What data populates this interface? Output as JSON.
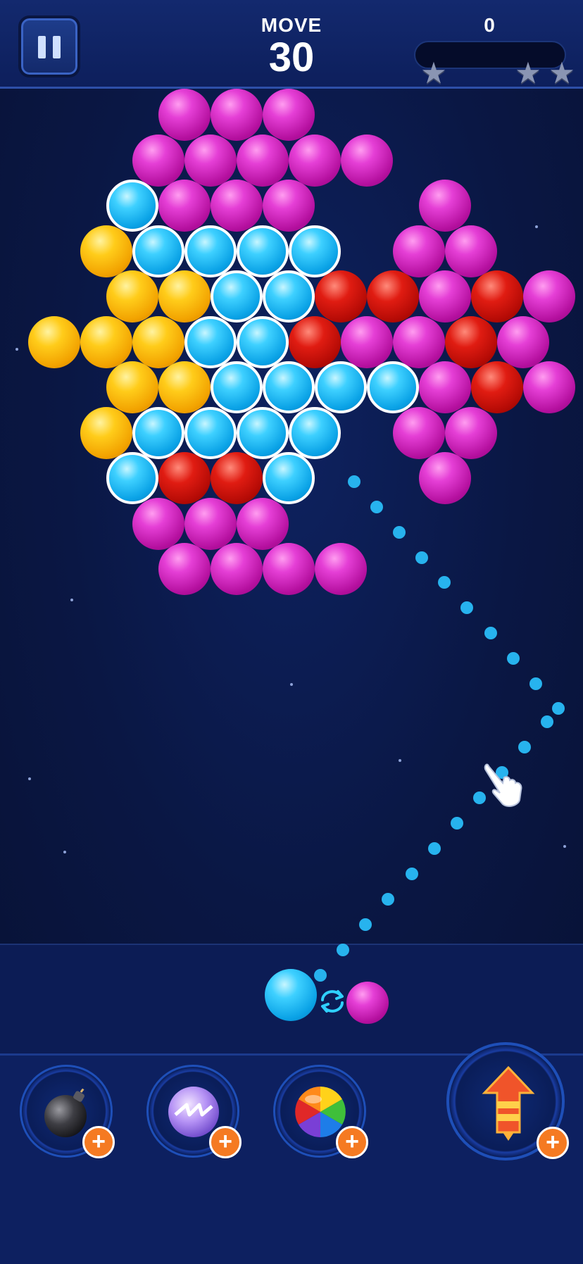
{
  "hud": {
    "pause_icon": "pause-icon",
    "move_label": "MOVE",
    "moves_left": "30",
    "score": "0",
    "score_progress": 0,
    "stars_earned": 0,
    "stars_total": 3,
    "star_icon": "star-icon"
  },
  "board": {
    "colors": {
      "magenta": "#c91cb6",
      "blue": "#12b4f0",
      "yellow": "#f6b80b",
      "red": "#c80e08"
    },
    "bubbles": [
      [
        "magenta",
        0,
        2
      ],
      [
        "magenta",
        0,
        3
      ],
      [
        "magenta",
        0,
        4
      ],
      [
        "magenta",
        1,
        2
      ],
      [
        "magenta",
        1,
        3
      ],
      [
        "magenta",
        1,
        4
      ],
      [
        "magenta",
        1,
        5
      ],
      [
        "magenta",
        1,
        6
      ],
      [
        "blue",
        2,
        1
      ],
      [
        "magenta",
        2,
        2
      ],
      [
        "magenta",
        2,
        3
      ],
      [
        "magenta",
        2,
        4
      ],
      [
        "magenta",
        2,
        7
      ],
      [
        "yellow",
        3,
        1
      ],
      [
        "blue",
        3,
        2
      ],
      [
        "blue",
        3,
        3
      ],
      [
        "blue",
        3,
        4
      ],
      [
        "blue",
        3,
        5
      ],
      [
        "magenta",
        3,
        7
      ],
      [
        "magenta",
        3,
        8
      ],
      [
        "yellow",
        4,
        1
      ],
      [
        "yellow",
        4,
        2
      ],
      [
        "blue",
        4,
        3
      ],
      [
        "blue",
        4,
        4
      ],
      [
        "red",
        4,
        5
      ],
      [
        "red",
        4,
        6
      ],
      [
        "magenta",
        4,
        7
      ],
      [
        "red",
        4,
        8
      ],
      [
        "magenta",
        4,
        9
      ],
      [
        "yellow",
        5,
        0
      ],
      [
        "yellow",
        5,
        1
      ],
      [
        "yellow",
        5,
        2
      ],
      [
        "blue",
        5,
        3
      ],
      [
        "blue",
        5,
        4
      ],
      [
        "red",
        5,
        5
      ],
      [
        "magenta",
        5,
        6
      ],
      [
        "magenta",
        5,
        7
      ],
      [
        "red",
        5,
        8
      ],
      [
        "magenta",
        5,
        9
      ],
      [
        "yellow",
        6,
        1
      ],
      [
        "yellow",
        6,
        2
      ],
      [
        "blue",
        6,
        3
      ],
      [
        "blue",
        6,
        4
      ],
      [
        "blue",
        6,
        5
      ],
      [
        "blue",
        6,
        6
      ],
      [
        "magenta",
        6,
        7
      ],
      [
        "red",
        6,
        8
      ],
      [
        "magenta",
        6,
        9
      ],
      [
        "yellow",
        7,
        1
      ],
      [
        "blue",
        7,
        2
      ],
      [
        "blue",
        7,
        3
      ],
      [
        "blue",
        7,
        4
      ],
      [
        "blue",
        7,
        5
      ],
      [
        "magenta",
        7,
        7
      ],
      [
        "magenta",
        7,
        8
      ],
      [
        "blue",
        8,
        1
      ],
      [
        "red",
        8,
        2
      ],
      [
        "red",
        8,
        3
      ],
      [
        "blue",
        8,
        4
      ],
      [
        "magenta",
        8,
        7
      ],
      [
        "magenta",
        9,
        2
      ],
      [
        "magenta",
        9,
        3
      ],
      [
        "magenta",
        9,
        4
      ],
      [
        "magenta",
        10,
        2
      ],
      [
        "magenta",
        10,
        3
      ],
      [
        "magenta",
        10,
        4
      ],
      [
        "magenta",
        10,
        5
      ]
    ]
  },
  "shooter": {
    "current_color": "blue",
    "next_color": "magenta",
    "swap_icon": "swap-arrows-icon",
    "hint_icon": "pointing-hand-icon"
  },
  "boosters": [
    {
      "name": "bomb",
      "icon": "bomb-icon",
      "add": "+"
    },
    {
      "name": "lightning",
      "icon": "lightning-ball-icon",
      "add": "+"
    },
    {
      "name": "rainbow",
      "icon": "rainbow-ball-icon",
      "add": "+"
    },
    {
      "name": "rocket",
      "icon": "rocket-icon",
      "add": "+"
    }
  ]
}
